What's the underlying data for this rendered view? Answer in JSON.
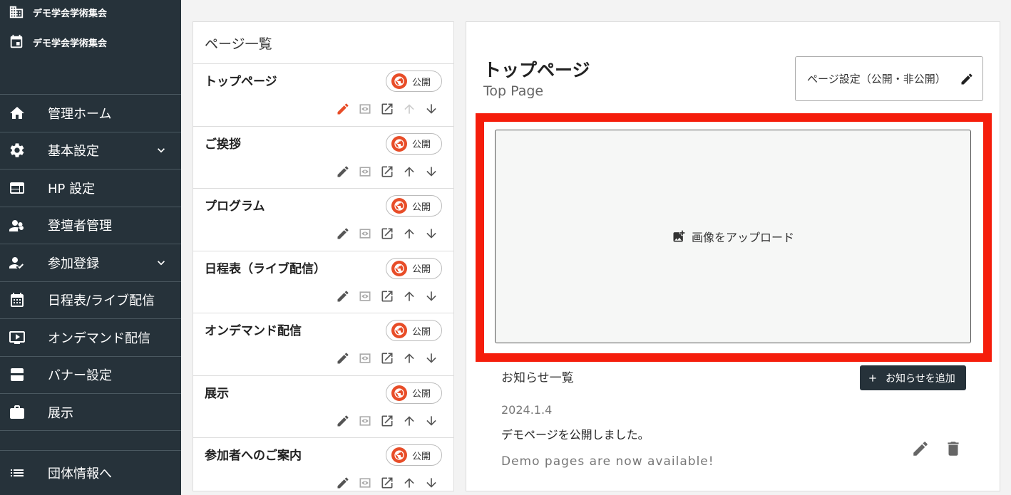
{
  "sidebar": {
    "org_name": "デモ学会学術集会",
    "event_name": "デモ学会学術集会",
    "items": [
      {
        "label": "管理ホーム",
        "icon": "home-icon"
      },
      {
        "label": "基本設定",
        "icon": "gear-icon",
        "expandable": true
      },
      {
        "label": "HP 設定",
        "icon": "web-layout-icon"
      },
      {
        "label": "登壇者管理",
        "icon": "speakers-icon"
      },
      {
        "label": "参加登録",
        "icon": "person-check-icon",
        "expandable": true
      },
      {
        "label": "日程表/ライブ配信",
        "icon": "calendar-icon"
      },
      {
        "label": "オンデマンド配信",
        "icon": "video-icon"
      },
      {
        "label": "バナー設定",
        "icon": "banner-icon"
      },
      {
        "label": "展示",
        "icon": "briefcase-icon"
      }
    ],
    "footer_label": "団体情報へ"
  },
  "pages": {
    "title": "ページ一覧",
    "status_label": "公開",
    "items": [
      {
        "name": "トップページ",
        "editing": true,
        "first": true
      },
      {
        "name": "ご挨拶"
      },
      {
        "name": "プログラム"
      },
      {
        "name": "日程表（ライブ配信）"
      },
      {
        "name": "オンデマンド配信"
      },
      {
        "name": "展示"
      },
      {
        "name": "参加者へのご案内"
      }
    ]
  },
  "main": {
    "title": "トップページ",
    "subtitle": "Top Page",
    "settings_button": "ページ設定（公開・非公開）",
    "upload_label": "画像をアップロード",
    "highlight_color": "#f51d0b",
    "news": {
      "title": "お知らせ一覧",
      "add_button": "お知らせを追加",
      "entries": [
        {
          "date": "2024.1.4",
          "text": "デモページを公開しました。",
          "text_en": "Demo pages are now available!"
        }
      ]
    }
  },
  "colors": {
    "sidebar_bg": "#26323a",
    "accent": "#e84d28"
  }
}
